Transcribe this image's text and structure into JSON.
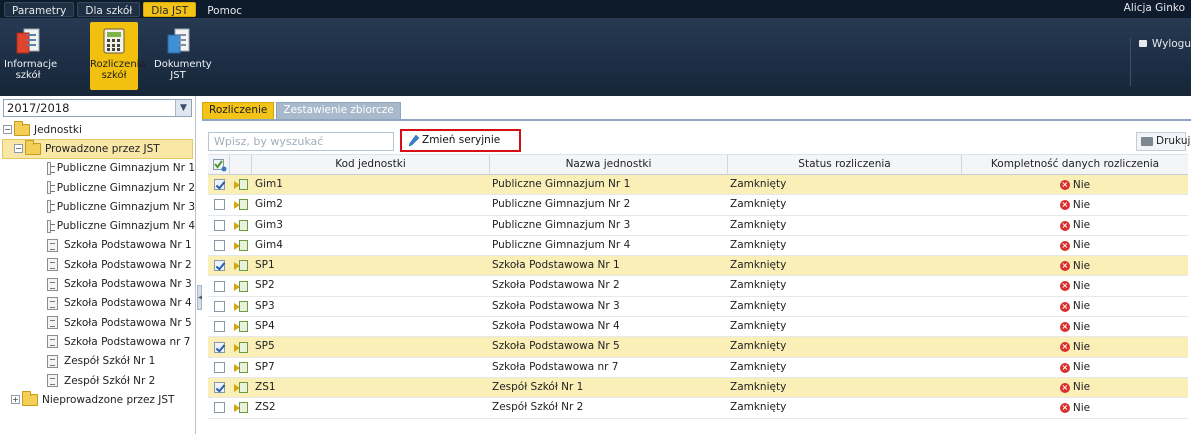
{
  "menubar": {
    "items": [
      "Parametry",
      "Dla szkół",
      "Dla JST",
      "Pomoc"
    ],
    "user": "Alicja Ginko"
  },
  "ribbon": {
    "buttons": [
      "Informacje szkół",
      "Rozliczenia szkół",
      "Dokumenty JST"
    ],
    "logout": "Wylogu"
  },
  "left": {
    "year": "2017/2018",
    "tree": {
      "root": "Jednostki",
      "group1": "Prowadzone przez JST",
      "schools": [
        "Publiczne Gimnazjum Nr 1",
        "Publiczne Gimnazjum Nr 2",
        "Publiczne Gimnazjum Nr 3",
        "Publiczne Gimnazjum Nr 4",
        "Szkoła Podstawowa Nr 1",
        "Szkoła Podstawowa Nr 2",
        "Szkoła Podstawowa Nr 3",
        "Szkoła Podstawowa Nr 4",
        "Szkoła Podstawowa Nr 5",
        "Szkoła Podstawowa nr 7",
        "Zespół Szkół Nr 1",
        "Zespół Szkół Nr 2"
      ],
      "group2": "Nieprowadzone przez JST"
    }
  },
  "main": {
    "tabs": [
      "Rozliczenie",
      "Zestawienie zbiorcze"
    ],
    "search_placeholder": "Wpisz, by wyszukać",
    "status_button": "Zmień seryjnie status",
    "print_button": "Drukuj",
    "columns": [
      "Kod jednostki",
      "Nazwa jednostki",
      "Status rozliczenia",
      "Kompletność danych rozliczenia"
    ],
    "rows": [
      {
        "checked": true,
        "kod": "Gim1",
        "nazwa": "Publiczne Gimnazjum Nr 1",
        "status": "Zamknięty",
        "komp": "Nie"
      },
      {
        "checked": false,
        "kod": "Gim2",
        "nazwa": "Publiczne Gimnazjum Nr 2",
        "status": "Zamknięty",
        "komp": "Nie"
      },
      {
        "checked": false,
        "kod": "Gim3",
        "nazwa": "Publiczne Gimnazjum Nr 3",
        "status": "Zamknięty",
        "komp": "Nie"
      },
      {
        "checked": false,
        "kod": "Gim4",
        "nazwa": "Publiczne Gimnazjum Nr 4",
        "status": "Zamknięty",
        "komp": "Nie"
      },
      {
        "checked": true,
        "kod": "SP1",
        "nazwa": "Szkoła Podstawowa Nr 1",
        "status": "Zamknięty",
        "komp": "Nie"
      },
      {
        "checked": false,
        "kod": "SP2",
        "nazwa": "Szkoła Podstawowa Nr 2",
        "status": "Zamknięty",
        "komp": "Nie"
      },
      {
        "checked": false,
        "kod": "SP3",
        "nazwa": "Szkoła Podstawowa Nr 3",
        "status": "Zamknięty",
        "komp": "Nie"
      },
      {
        "checked": false,
        "kod": "SP4",
        "nazwa": "Szkoła Podstawowa Nr 4",
        "status": "Zamknięty",
        "komp": "Nie"
      },
      {
        "checked": true,
        "kod": "SP5",
        "nazwa": "Szkoła Podstawowa Nr 5",
        "status": "Zamknięty",
        "komp": "Nie"
      },
      {
        "checked": false,
        "kod": "SP7",
        "nazwa": "Szkoła Podstawowa nr 7",
        "status": "Zamknięty",
        "komp": "Nie"
      },
      {
        "checked": true,
        "kod": "ZS1",
        "nazwa": "Zespół Szkół Nr 1",
        "status": "Zamknięty",
        "komp": "Nie"
      },
      {
        "checked": false,
        "kod": "ZS2",
        "nazwa": "Zespół Szkół Nr 2",
        "status": "Zamknięty",
        "komp": "Nie"
      }
    ]
  },
  "colors": {
    "accent": "#f3c417",
    "dark_bar": "#0d1b2b",
    "selected_row": "#fbefb8",
    "highlight_border": "#d80f12",
    "no_icon": "#d8302a"
  }
}
